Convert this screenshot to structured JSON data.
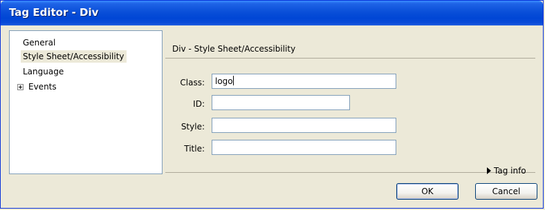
{
  "window": {
    "title": "Tag Editor - Div"
  },
  "tree": {
    "items": [
      {
        "label": "General",
        "selected": false
      },
      {
        "label": "Style Sheet/Accessibility",
        "selected": true
      },
      {
        "label": "Language",
        "selected": false
      },
      {
        "label": "Events",
        "selected": false,
        "expandable": true
      }
    ]
  },
  "panel": {
    "title": "Div - Style Sheet/Accessibility",
    "fields": {
      "class": {
        "label": "Class:",
        "value": "logo"
      },
      "id": {
        "label": "ID:",
        "value": ""
      },
      "style": {
        "label": "Style:",
        "value": ""
      },
      "title": {
        "label": "Title:",
        "value": ""
      }
    },
    "tag_info": "Tag info"
  },
  "buttons": {
    "ok": "OK",
    "cancel": "Cancel"
  },
  "colors": {
    "titlebar": "#0a4fd8",
    "dialog_bg": "#ece9d8",
    "field_border": "#7f9db9"
  }
}
